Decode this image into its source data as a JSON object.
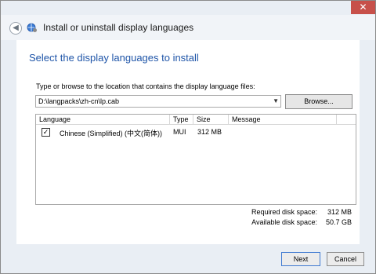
{
  "window": {
    "title": "Install or uninstall display languages",
    "close_glyph": "✕"
  },
  "nav": {
    "back_glyph": "◀"
  },
  "page": {
    "heading": "Select the display languages to install"
  },
  "source": {
    "label": "Type or browse to the location that contains the display language files:",
    "path": "D:\\langpacks\\zh-cn\\lp.cab",
    "browse_label": "Browse..."
  },
  "list": {
    "columns": [
      "Language",
      "Type",
      "Size",
      "Message"
    ],
    "rows": [
      {
        "checked": true,
        "language": "Chinese (Simplified) (中文(简体))",
        "type": "MUI",
        "size": "312 MB",
        "message": ""
      }
    ]
  },
  "disk": {
    "required_label": "Required disk space:",
    "required_value": "312 MB",
    "available_label": "Available disk space:",
    "available_value": "50.7 GB"
  },
  "buttons": {
    "next": "Next",
    "cancel": "Cancel"
  },
  "colors": {
    "accent": "#1f55a8",
    "close": "#c7504a"
  }
}
